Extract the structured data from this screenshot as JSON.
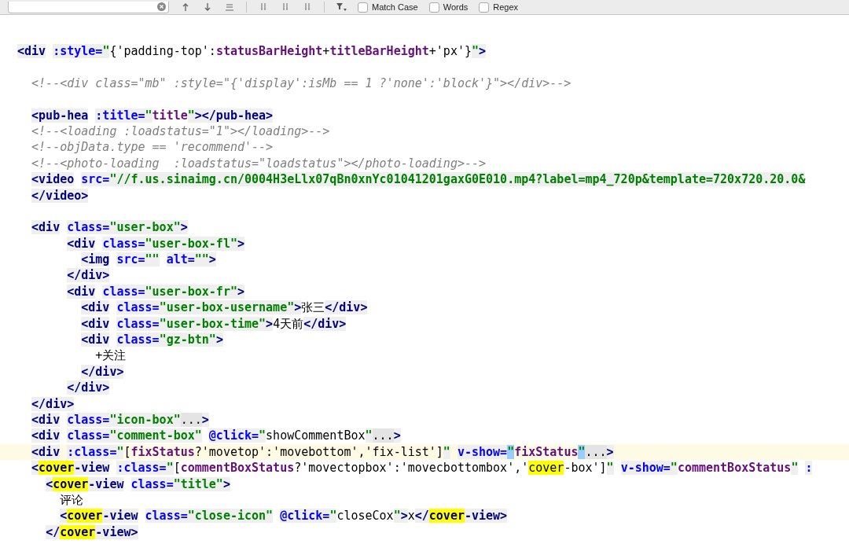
{
  "find_bar": {
    "options": [
      {
        "label": "Match Case",
        "checked": false
      },
      {
        "label": "Words",
        "checked": false
      },
      {
        "label": "Regex",
        "checked": false
      }
    ]
  },
  "lines": [
    {
      "current": false,
      "tokens": [
        {
          "kind": "tag",
          "text": "<div"
        },
        {
          "kind": "attr",
          "text": " :style="
        },
        {
          "kind": "str",
          "text": "\""
        },
        {
          "kind": "plain",
          "text": "{'padding-top':"
        },
        {
          "kind": "var",
          "text": "statusBarHeight"
        },
        {
          "kind": "plain",
          "text": "+"
        },
        {
          "kind": "var",
          "text": "titleBarHeight"
        },
        {
          "kind": "plain",
          "text": "+'px'}"
        },
        {
          "kind": "str",
          "text": "\""
        },
        {
          "kind": "tag",
          "text": ">"
        }
      ]
    },
    {
      "current": false
    },
    {
      "current": false,
      "tokens": [
        {
          "kind": "comment",
          "text": "  <!--<div class=\"mb\" :style=\"{'display':isMb == 1 ?'none':'block'}\"></div>-->"
        }
      ]
    },
    {
      "current": false
    },
    {
      "current": false,
      "tokens": [
        {
          "kind": "tag",
          "text": "  <pub-hea"
        },
        {
          "kind": "attr",
          "text": " :title="
        },
        {
          "kind": "str",
          "text": "\""
        },
        {
          "kind": "var",
          "text": "title"
        },
        {
          "kind": "str",
          "text": "\""
        },
        {
          "kind": "tag",
          "text": "></pub-hea>"
        }
      ]
    },
    {
      "current": false,
      "tokens": [
        {
          "kind": "comment",
          "text": "  <!--<loading :loadstatus=\"1\"></loading>-->"
        }
      ]
    },
    {
      "current": false,
      "tokens": [
        {
          "kind": "comment",
          "text": "  <!--objData.type == 'recommend'-->"
        }
      ]
    },
    {
      "current": false,
      "tokens": [
        {
          "kind": "comment",
          "text": "  <!--<photo-loading  :loadstatus=\"loadstatus\"></photo-loading>-->"
        }
      ]
    },
    {
      "current": false,
      "tokens": [
        {
          "kind": "tag",
          "text": "  <video"
        },
        {
          "kind": "attr",
          "text": " src="
        },
        {
          "kind": "str",
          "text": "\"//f.us.sinaimg.cn/0004H3eLlx07qBn0xnYc01041201gaxG0E010.mp4?label=mp4_720p&template=720x720.20.0&"
        }
      ]
    },
    {
      "current": false,
      "tokens": [
        {
          "kind": "tag",
          "text": "  </video>"
        }
      ]
    },
    {
      "current": false
    },
    {
      "current": false,
      "tokens": [
        {
          "kind": "tag",
          "text": "  <div"
        },
        {
          "kind": "attr",
          "text": " class="
        },
        {
          "kind": "str",
          "text": "\"user-box\""
        },
        {
          "kind": "tag",
          "text": ">"
        }
      ]
    },
    {
      "current": false,
      "tokens": [
        {
          "kind": "tag",
          "text": "       <div"
        },
        {
          "kind": "attr",
          "text": " class="
        },
        {
          "kind": "str",
          "text": "\"user-box-fl\""
        },
        {
          "kind": "tag",
          "text": ">"
        }
      ]
    },
    {
      "current": false,
      "tokens": [
        {
          "kind": "tag",
          "text": "         <img"
        },
        {
          "kind": "attr",
          "text": " src="
        },
        {
          "kind": "str",
          "text": "\"\""
        },
        {
          "kind": "attr",
          "text": " alt="
        },
        {
          "kind": "str",
          "text": "\"\""
        },
        {
          "kind": "tag",
          "text": ">"
        }
      ]
    },
    {
      "current": false,
      "tokens": [
        {
          "kind": "tag",
          "text": "       </div>"
        }
      ]
    },
    {
      "current": false,
      "tokens": [
        {
          "kind": "tag",
          "text": "       <div"
        },
        {
          "kind": "attr",
          "text": " class="
        },
        {
          "kind": "str",
          "text": "\"user-box-fr\""
        },
        {
          "kind": "tag",
          "text": ">"
        }
      ]
    },
    {
      "current": false,
      "tokens": [
        {
          "kind": "tag",
          "text": "         <div"
        },
        {
          "kind": "attr",
          "text": " class="
        },
        {
          "kind": "str",
          "text": "\"user-box-username\""
        },
        {
          "kind": "tag",
          "text": ">"
        },
        {
          "kind": "plain",
          "text": "张三"
        },
        {
          "kind": "tag",
          "text": "</div>"
        }
      ]
    },
    {
      "current": false,
      "tokens": [
        {
          "kind": "tag",
          "text": "         <div"
        },
        {
          "kind": "attr",
          "text": " class="
        },
        {
          "kind": "str",
          "text": "\"user-box-time\""
        },
        {
          "kind": "tag",
          "text": ">"
        },
        {
          "kind": "plain",
          "text": "4天前"
        },
        {
          "kind": "tag",
          "text": "</div>"
        }
      ]
    },
    {
      "current": false,
      "tokens": [
        {
          "kind": "tag",
          "text": "         <div"
        },
        {
          "kind": "attr",
          "text": " class="
        },
        {
          "kind": "str",
          "text": "\"gz-btn\""
        },
        {
          "kind": "tag",
          "text": ">"
        }
      ]
    },
    {
      "current": false,
      "tokens": [
        {
          "kind": "plain",
          "text": "           +关注"
        }
      ]
    },
    {
      "current": false,
      "tokens": [
        {
          "kind": "tag",
          "text": "         </div>"
        }
      ]
    },
    {
      "current": false,
      "tokens": [
        {
          "kind": "tag",
          "text": "       </div>"
        }
      ]
    },
    {
      "current": false,
      "tokens": [
        {
          "kind": "tag",
          "text": "  </div>"
        }
      ]
    },
    {
      "current": false,
      "tokens": [
        {
          "kind": "tag",
          "text": "  <div"
        },
        {
          "kind": "attr",
          "text": " class="
        },
        {
          "kind": "str",
          "text": "\"icon-box\""
        },
        {
          "kind": "fold",
          "text": "..."
        },
        {
          "kind": "tag",
          "text": ">"
        }
      ]
    },
    {
      "current": false,
      "tokens": [
        {
          "kind": "tag",
          "text": "  <div"
        },
        {
          "kind": "attr",
          "text": " class="
        },
        {
          "kind": "str",
          "text": "\"comment-box\""
        },
        {
          "kind": "attr",
          "text": " @click="
        },
        {
          "kind": "str",
          "text": "\""
        },
        {
          "kind": "plain",
          "text": "showCommentBox"
        },
        {
          "kind": "str",
          "text": "\""
        },
        {
          "kind": "fold",
          "text": "..."
        },
        {
          "kind": "tag",
          "text": ">"
        }
      ]
    },
    {
      "current": true,
      "tokens": [
        {
          "kind": "tag",
          "text": "  <div"
        },
        {
          "kind": "attr",
          "text": " :class="
        },
        {
          "kind": "str",
          "text": "\""
        },
        {
          "kind": "plain",
          "text": "["
        },
        {
          "kind": "var",
          "text": "fixStatus"
        },
        {
          "kind": "plain",
          "text": "?'movetop':'movebottom','fix-list']"
        },
        {
          "kind": "str",
          "text": "\""
        },
        {
          "kind": "attr",
          "text": " v-show="
        },
        {
          "kind": "str-paired",
          "text": "\""
        },
        {
          "kind": "var",
          "text": "fixStatus"
        },
        {
          "kind": "str-paired",
          "text": "\""
        },
        {
          "kind": "fold",
          "text": "..."
        },
        {
          "kind": "tag",
          "text": ">"
        }
      ]
    },
    {
      "current": false,
      "tokens": [
        {
          "kind": "tag",
          "text": "  <"
        },
        {
          "kind": "tag-match",
          "text": "cover"
        },
        {
          "kind": "tag",
          "text": "-view"
        },
        {
          "kind": "attr",
          "text": " :class="
        },
        {
          "kind": "str",
          "text": "\""
        },
        {
          "kind": "plain",
          "text": "["
        },
        {
          "kind": "var",
          "text": "commentBoxStatus"
        },
        {
          "kind": "plain",
          "text": "?'movectopbox':'movecbottombox','"
        },
        {
          "kind": "plain-match",
          "text": "cover"
        },
        {
          "kind": "plain",
          "text": "-box']"
        },
        {
          "kind": "str",
          "text": "\""
        },
        {
          "kind": "attr",
          "text": " v-show="
        },
        {
          "kind": "str",
          "text": "\""
        },
        {
          "kind": "var",
          "text": "commentBoxStatus"
        },
        {
          "kind": "str",
          "text": "\""
        },
        {
          "kind": "attr",
          "text": " :"
        }
      ]
    },
    {
      "current": false,
      "tokens": [
        {
          "kind": "tag",
          "text": "    <"
        },
        {
          "kind": "tag-match",
          "text": "cover"
        },
        {
          "kind": "tag",
          "text": "-view"
        },
        {
          "kind": "attr",
          "text": " class="
        },
        {
          "kind": "str",
          "text": "\"title\""
        },
        {
          "kind": "tag",
          "text": ">"
        }
      ]
    },
    {
      "current": false,
      "tokens": [
        {
          "kind": "plain",
          "text": "      评论"
        }
      ]
    },
    {
      "current": false,
      "tokens": [
        {
          "kind": "tag",
          "text": "      <"
        },
        {
          "kind": "tag-match",
          "text": "cover"
        },
        {
          "kind": "tag",
          "text": "-view"
        },
        {
          "kind": "attr",
          "text": " class="
        },
        {
          "kind": "str",
          "text": "\"close-icon\""
        },
        {
          "kind": "attr",
          "text": " @click="
        },
        {
          "kind": "str",
          "text": "\""
        },
        {
          "kind": "plain",
          "text": "closeCox"
        },
        {
          "kind": "str",
          "text": "\""
        },
        {
          "kind": "tag",
          "text": ">"
        },
        {
          "kind": "plain",
          "text": "x"
        },
        {
          "kind": "tag",
          "text": "</"
        },
        {
          "kind": "tag-match",
          "text": "cover"
        },
        {
          "kind": "tag",
          "text": "-view>"
        }
      ]
    },
    {
      "current": false,
      "tokens": [
        {
          "kind": "tag",
          "text": "    </"
        },
        {
          "kind": "tag-match",
          "text": "cover"
        },
        {
          "kind": "tag",
          "text": "-view>"
        }
      ]
    }
  ]
}
